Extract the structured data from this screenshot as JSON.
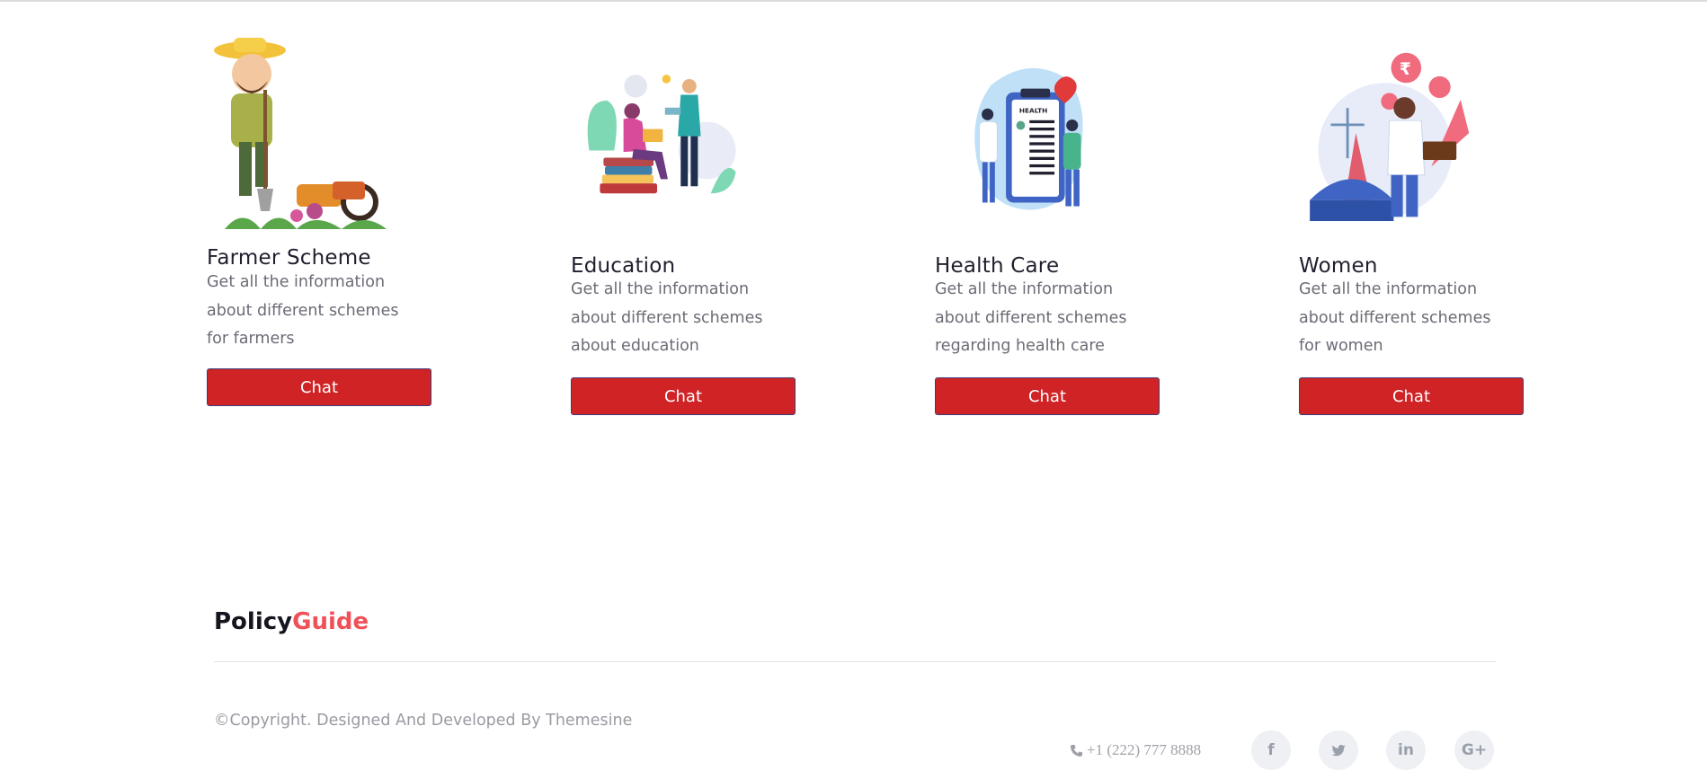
{
  "cards": [
    {
      "title": "Farmer Scheme",
      "desc_lines": [
        "Get all the information",
        "about different schemes",
        "for farmers"
      ],
      "button_label": "Chat",
      "illustration": "farmer-illustration"
    },
    {
      "title": "Education",
      "desc_lines": [
        "Get all the information",
        "about different schemes",
        "about education"
      ],
      "button_label": "Chat",
      "illustration": "education-illustration"
    },
    {
      "title": "Health Care",
      "desc_lines": [
        "Get all the information",
        "about different schemes",
        "regarding health care"
      ],
      "button_label": "Chat",
      "illustration": "health-care-illustration",
      "illustration_text": "HEALTH"
    },
    {
      "title": "Women",
      "desc_lines": [
        "Get all the information",
        "about different schemes",
        "for women"
      ],
      "button_label": "Chat",
      "illustration": "women-illustration",
      "illustration_text": "₹"
    }
  ],
  "footer": {
    "logo_part1": "Policy",
    "logo_part2": "Guide",
    "copyright": "©Copyright. Designed And Developed By Themesine",
    "phone": "+1 (222) 777 8888",
    "social": [
      {
        "icon": "facebook-icon",
        "glyph": "f"
      },
      {
        "icon": "twitter-icon",
        "glyph": "🐦"
      },
      {
        "icon": "linkedin-icon",
        "glyph": "in"
      },
      {
        "icon": "google-plus-icon",
        "glyph": "G+"
      }
    ]
  },
  "colors": {
    "button": "#cf2326",
    "brand_accent": "#ef5158",
    "text_dark": "#1f1f2e",
    "text_muted": "#6b6b76"
  }
}
